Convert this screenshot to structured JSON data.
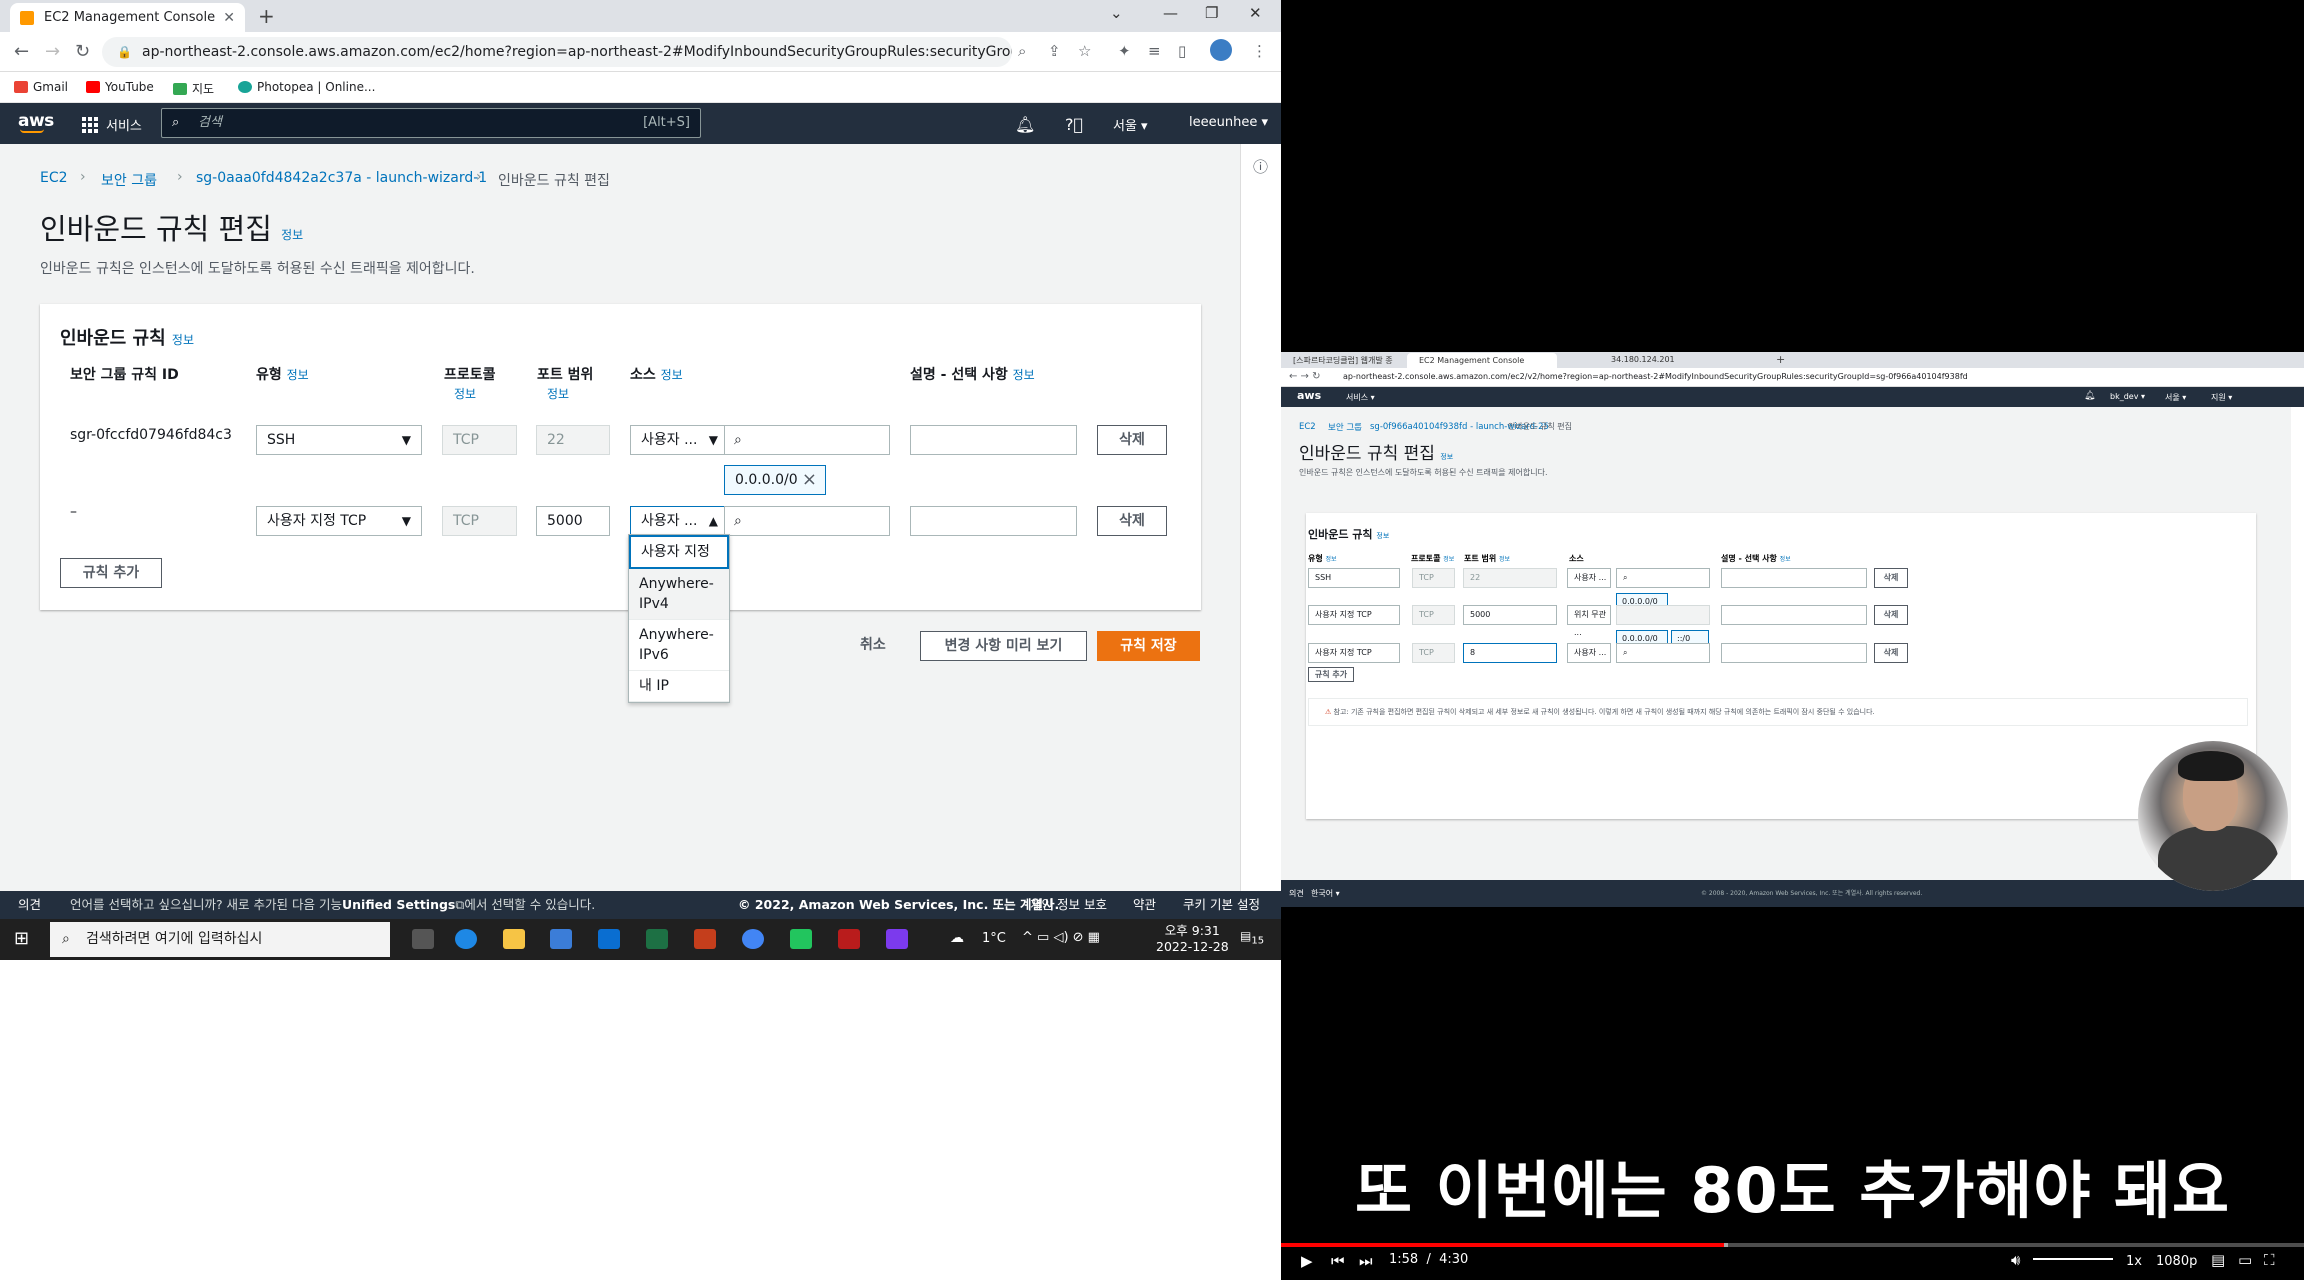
{
  "browser": {
    "tab_title": "EC2 Management Console",
    "url": "ap-northeast-2.console.aws.amazon.com/ec2/home?region=ap-northeast-2#ModifyInboundSecurityGroupRules:securityGroupId=sg-0...",
    "bookmarks": [
      "Gmail",
      "YouTube",
      "지도",
      "Photopea | Online..."
    ]
  },
  "aws_nav": {
    "logo": "aws",
    "services": "서비스",
    "search_placeholder": "검색",
    "search_shortcut": "[Alt+S]",
    "region": "서울 ▾",
    "user": "leeeunhee ▾"
  },
  "breadcrumb": {
    "ec2": "EC2",
    "sg": "보안 그룹",
    "sg_id": "sg-0aaa0fd4842a2c37a - launch-wizard-1",
    "current": "인바운드 규칙 편집"
  },
  "page": {
    "title": "인바운드 규칙 편집",
    "info": "정보",
    "description": "인바운드 규칙은 인스턴스에 도달하도록 허용된 수신 트래픽을 제어합니다."
  },
  "rules_panel": {
    "title": "인바운드 규칙",
    "info": "정보",
    "col_id": "보안 그룹 규칙 ID",
    "col_type": "유형",
    "col_protocol": "프로토콜",
    "col_port": "포트 범위",
    "col_source": "소스",
    "col_desc": "설명 - 선택 사항",
    "rows": [
      {
        "id": "sgr-0fccfd07946fd84c3",
        "type": "SSH",
        "protocol": "TCP",
        "port": "22",
        "source": "사용자 ...",
        "cidr": "0.0.0.0/0",
        "delete": "삭제"
      },
      {
        "id": "–",
        "type": "사용자 지정 TCP",
        "protocol": "TCP",
        "port": "5000",
        "source": "사용자 ...",
        "delete": "삭제"
      }
    ],
    "add_rule": "규칙 추가",
    "source_options": [
      "사용자 지정",
      "Anywhere-IPv4",
      "Anywhere-IPv6",
      "내 IP"
    ]
  },
  "actions": {
    "cancel": "취소",
    "preview": "변경 사항 미리 보기",
    "save": "규칙 저장"
  },
  "footer": {
    "feedback": "의견",
    "lang_note_1": "언어를 선택하고 싶으십니까? 새로 추가된 다음 기능",
    "lang_note_bold": "Unified Settings",
    "lang_note_2": "에서 선택할 수 있습니다.",
    "copyright": "© 2022, Amazon Web Services, Inc. 또는 계열사.",
    "privacy": "개인 정보 보호",
    "terms": "약관",
    "cookies": "쿠키 기본 설정"
  },
  "taskbar": {
    "search_placeholder": "검색하려면 여기에 입력하십시",
    "weather": "1°C",
    "time": "오후 9:31",
    "date": "2022-12-28",
    "notif": "15"
  },
  "video": {
    "tabs": [
      "[스파르타코딩클럽] 웹개발 종합",
      "EC2 Management Console",
      "34.180.124.201"
    ],
    "url": "ap-northeast-2.console.aws.amazon.com/ec2/v2/home?region=ap-northeast-2#ModifyInboundSecurityGroupRules:securityGroupId=sg-0f966a40104f938fd",
    "services": "서비스 ▾",
    "user": "bk_dev ▾",
    "region": "서울 ▾",
    "support": "지원 ▾",
    "bc_ec2": "EC2",
    "bc_sg": "보안 그룹",
    "bc_id": "sg-0f966a40104f938fd - launch-wizard-25",
    "bc_cur": "인바운드 규칙 편집",
    "title": "인바운드 규칙 편집",
    "info": "정보",
    "desc": "인바운드 규칙은 인스턴스에 도달하도록 허용된 수신 트래픽을 제어합니다.",
    "panel_title": "인바운드 규칙",
    "col_type": "유형",
    "col_protocol": "프로토콜",
    "col_port": "포트 범위",
    "col_source": "소스",
    "col_desc": "설명 - 선택 사항",
    "rows": [
      {
        "type": "SSH",
        "protocol": "TCP",
        "port": "22",
        "source": "사용자 ...",
        "delete": "삭제"
      },
      {
        "type": "사용자 지정 TCP",
        "protocol": "TCP",
        "port": "5000",
        "source": "위치 무관 ...",
        "delete": "삭제"
      },
      {
        "type": "사용자 지정 TCP",
        "protocol": "TCP",
        "port": "8",
        "source": "사용자 ...",
        "delete": "삭제"
      }
    ],
    "cidr_v4": "0.0.0.0/0",
    "cidr_v6": "::/0",
    "add_rule": "규칙 추가",
    "warning": "참고: 기존 규칙을 편집하면 편집된 규칙이 삭제되고 새 세부 정보로 새 규칙이 생성됩니다. 이렇게 하면 새 규칙이 생성될 때까지 해당 규칙에 의존하는 트래픽이 잠시 중단될 수 있습니다.",
    "footer_left": "의견",
    "footer_lang": "한국어 ▾",
    "footer_copy": "© 2008 - 2020, Amazon Web Services, Inc. 또는 계열사. All rights reserved.",
    "subtitle": "또 이번에는 80도 추가해야 돼요",
    "time_current": "1:58",
    "time_sep": "/",
    "time_total": "4:30",
    "speed": "1x",
    "quality": "1080p"
  }
}
